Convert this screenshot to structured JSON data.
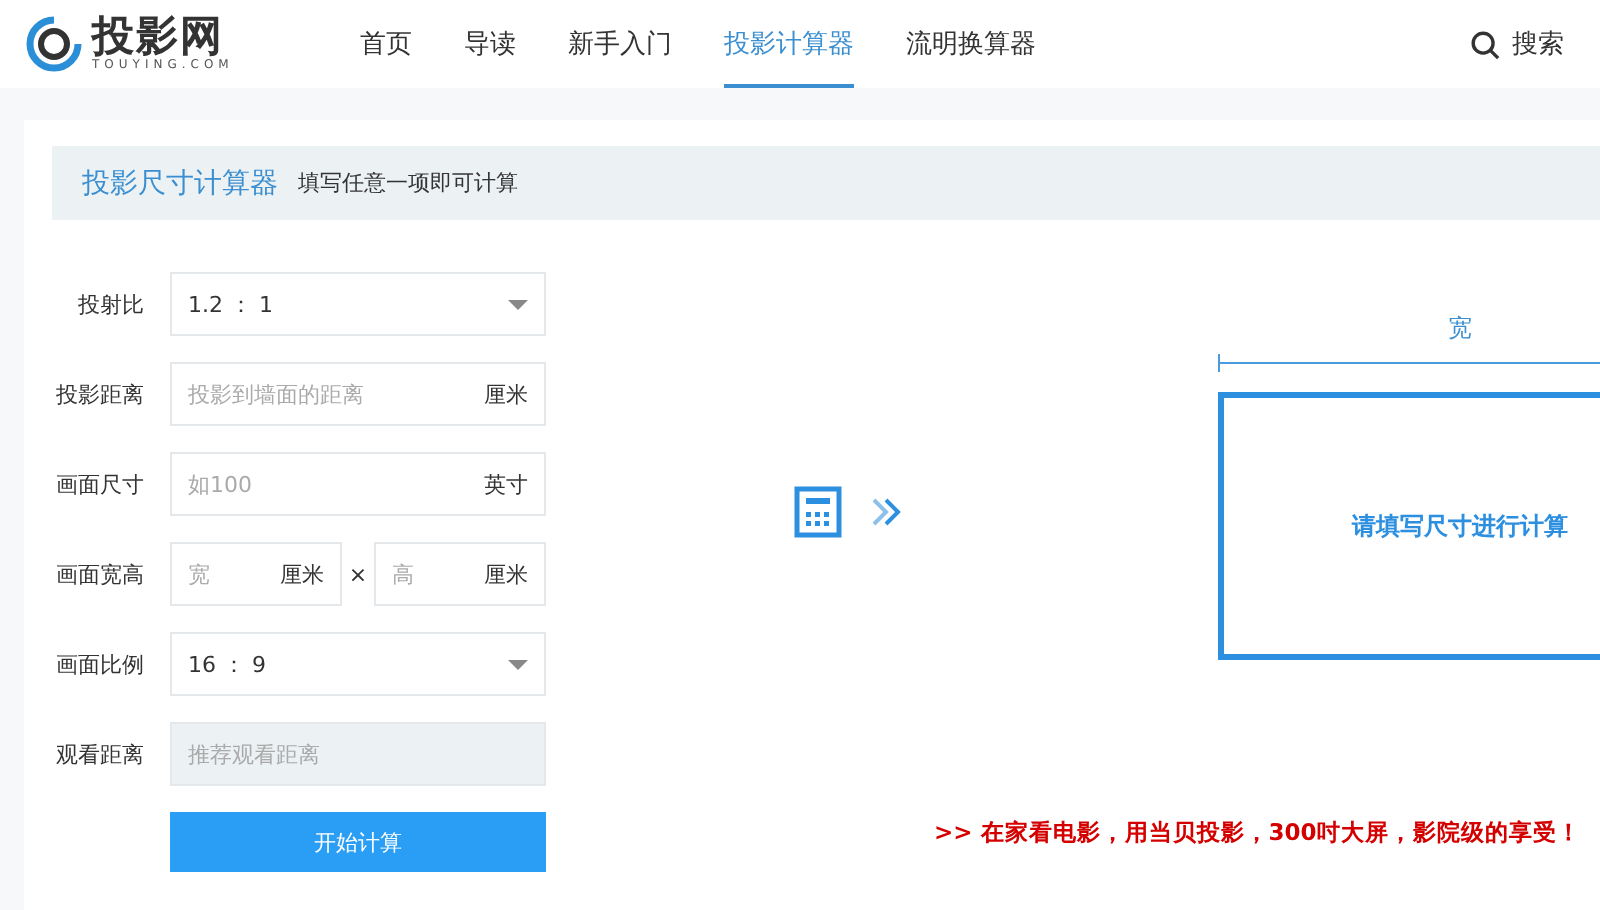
{
  "header": {
    "logo": {
      "name": "投影网",
      "domain": "TOUYING.COM"
    },
    "nav": [
      {
        "label": "首页",
        "selected": false
      },
      {
        "label": "导读",
        "selected": false
      },
      {
        "label": "新手入门",
        "selected": false
      },
      {
        "label": "投影计算器",
        "selected": true
      },
      {
        "label": "流明换算器",
        "selected": false
      }
    ],
    "search": {
      "label": "搜索"
    }
  },
  "calculator": {
    "title": "投影尺寸计算器",
    "hint": "填写任意一项即可计算",
    "fields": [
      {
        "kind": "select",
        "label": "投射比",
        "value": "1.2 ： 1",
        "disabled": false
      },
      {
        "kind": "input",
        "label": "投影距离",
        "placeholder": "投影到墙面的距离",
        "unit": "厘米",
        "disabled": false
      },
      {
        "kind": "input",
        "label": "画面尺寸",
        "placeholder": "如100",
        "unit": "英寸",
        "disabled": false
      },
      {
        "kind": "pair",
        "label": "画面宽高",
        "separator": "×",
        "parts": [
          {
            "placeholder": "宽",
            "unit": "厘米"
          },
          {
            "placeholder": "高",
            "unit": "厘米"
          }
        ],
        "disabled": false
      },
      {
        "kind": "select",
        "label": "画面比例",
        "value": "16 ： 9",
        "disabled": false
      },
      {
        "kind": "input",
        "label": "观看距离",
        "placeholder": "推荐观看距离",
        "disabled": true
      }
    ],
    "button": "开始计算"
  },
  "preview": {
    "dimension_label": "宽",
    "message": "请填写尺寸进行计算"
  },
  "promo": ">> 在家看电影，用当贝投影，300吋大屏，影院级的享受！"
}
